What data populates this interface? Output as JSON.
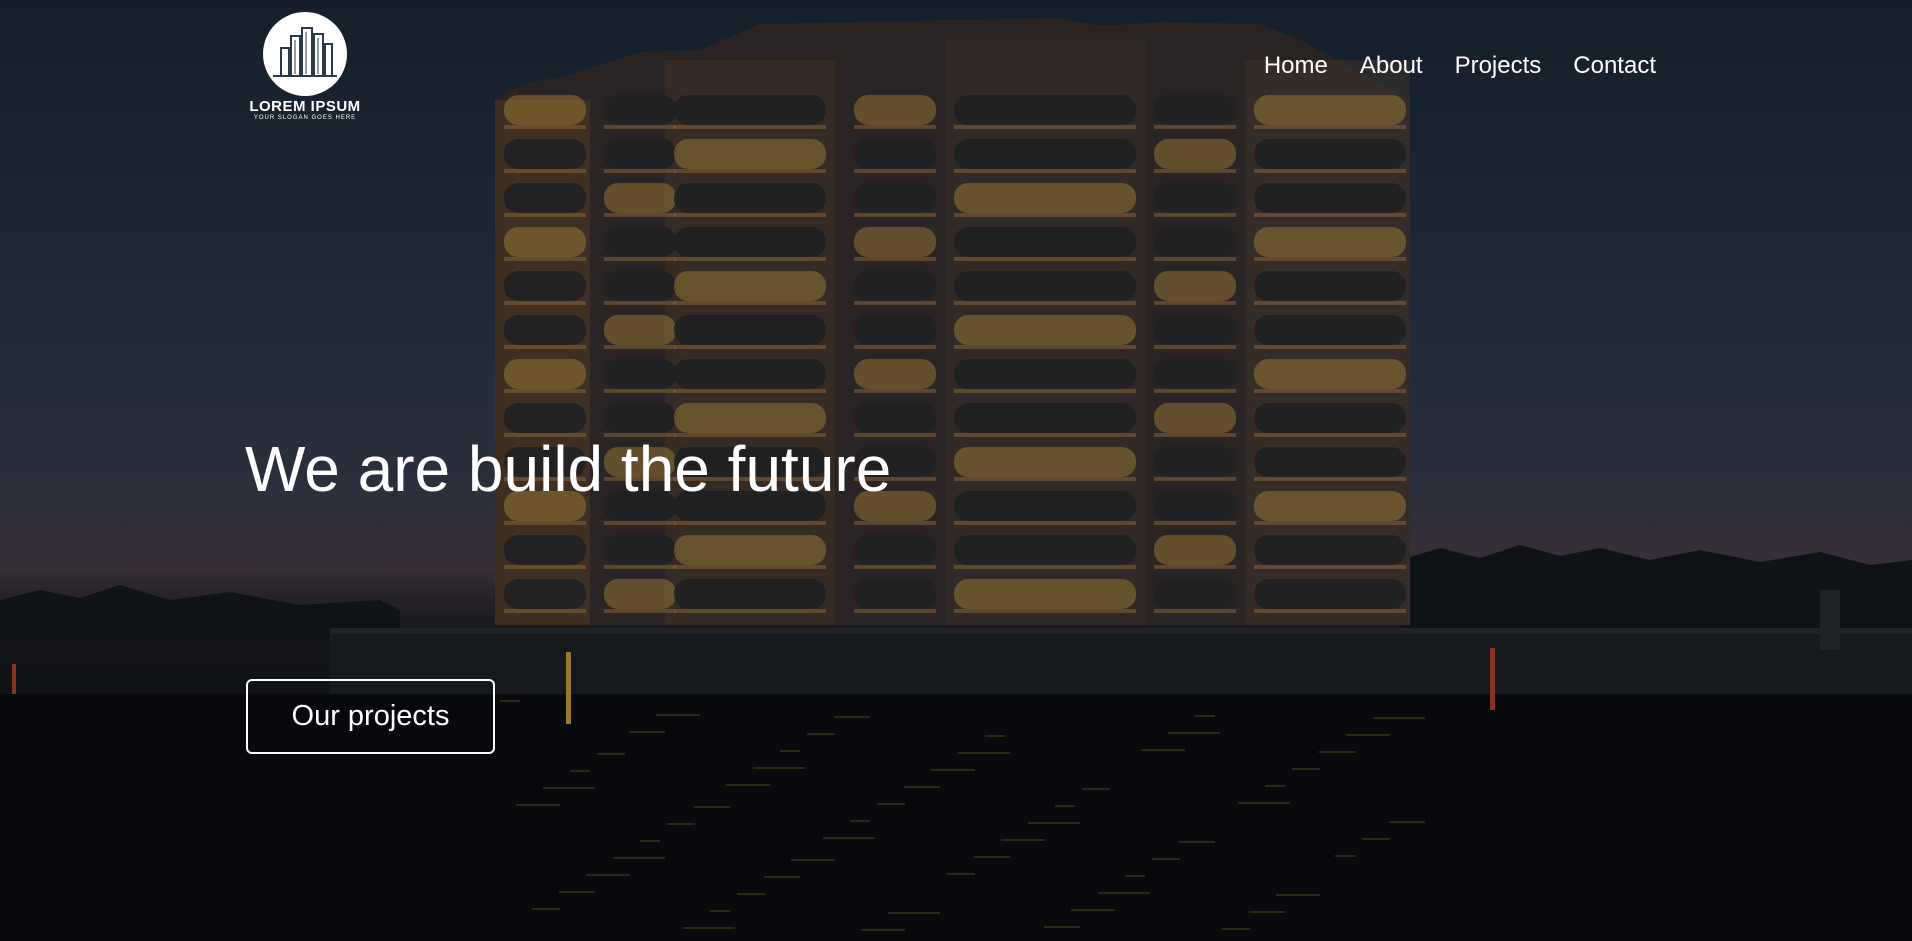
{
  "logo": {
    "name": "LOREM IPSUM",
    "slogan": "YOUR SLOGAN GOES HERE",
    "icon": "buildings-icon"
  },
  "nav": {
    "items": [
      {
        "label": "Home"
      },
      {
        "label": "About"
      },
      {
        "label": "Projects"
      },
      {
        "label": "Contact"
      }
    ]
  },
  "hero": {
    "headline": "We are build the future",
    "cta_label": "Our projects",
    "background": "apartment-building-at-dusk-by-water"
  },
  "colors": {
    "text": "#ffffff",
    "sky": "#1c2a3b",
    "water": "#090b10",
    "window_light": "#e0b24a"
  }
}
